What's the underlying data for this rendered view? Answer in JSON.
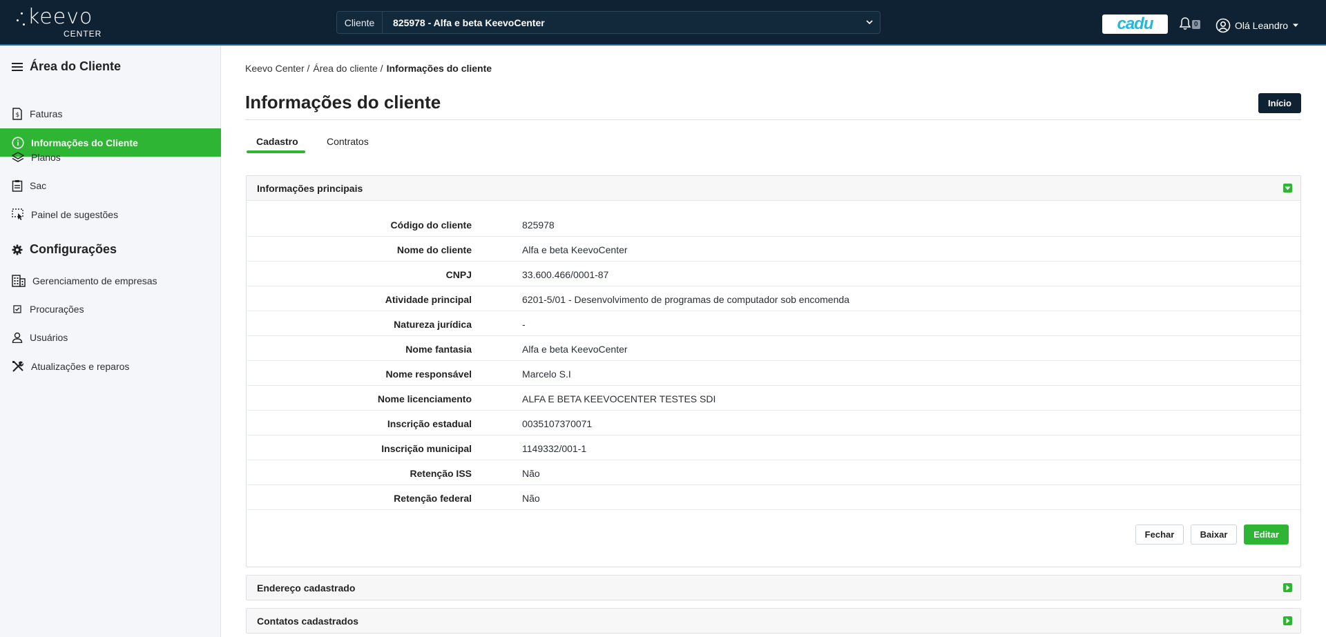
{
  "header": {
    "logo_text": "keevo",
    "logo_sub": "CENTER",
    "client_label": "Cliente",
    "client_value": "825978 - Alfa e beta KeevoCenter",
    "cadu_label": "cadu",
    "notification_count": "0",
    "user_greeting": "Olá Leandro"
  },
  "sidebar": {
    "section1_title": "Área do Cliente",
    "section1_items": [
      "Faturas",
      "Informações do Cliente",
      "Planos",
      "Sac",
      "Painel de sugestões"
    ],
    "section2_title": "Configurações",
    "section2_items": [
      "Gerenciamento de empresas",
      "Procurações",
      "Usuários",
      "Atualizações e reparos"
    ]
  },
  "breadcrumb": [
    "Keevo Center /",
    "Área do cliente /",
    "Informações do cliente"
  ],
  "page": {
    "title": "Informações do cliente",
    "inicio_label": "Início"
  },
  "tabs": [
    "Cadastro",
    "Contratos"
  ],
  "panels": {
    "main_title": "Informações principais",
    "address_title": "Endereço cadastrado",
    "contacts_title": "Contatos cadastrados"
  },
  "fields": [
    {
      "label": "Código do cliente",
      "value": "825978"
    },
    {
      "label": "Nome do cliente",
      "value": "Alfa e beta KeevoCenter"
    },
    {
      "label": "CNPJ",
      "value": "33.600.466/0001-87"
    },
    {
      "label": "Atividade principal",
      "value": "6201-5/01 - Desenvolvimento de programas de computador sob encomenda"
    },
    {
      "label": "Natureza jurídica",
      "value": "-"
    },
    {
      "label": "Nome fantasia",
      "value": "Alfa e beta KeevoCenter"
    },
    {
      "label": "Nome responsável",
      "value": "Marcelo S.I"
    },
    {
      "label": "Nome licenciamento",
      "value": "ALFA E BETA KEEVOCENTER TESTES SDI"
    },
    {
      "label": "Inscrição estadual",
      "value": "0035107370071"
    },
    {
      "label": "Inscrição municipal",
      "value": "1149332/001-1"
    },
    {
      "label": "Retenção ISS",
      "value": "Não"
    },
    {
      "label": "Retenção federal",
      "value": "Não"
    }
  ],
  "actions": {
    "close_label": "Fechar",
    "download_label": "Baixar",
    "edit_label": "Editar"
  },
  "colors": {
    "header_bg": "#0f2233",
    "accent_green": "#2db533",
    "cadu_blue": "#22b8e0"
  }
}
